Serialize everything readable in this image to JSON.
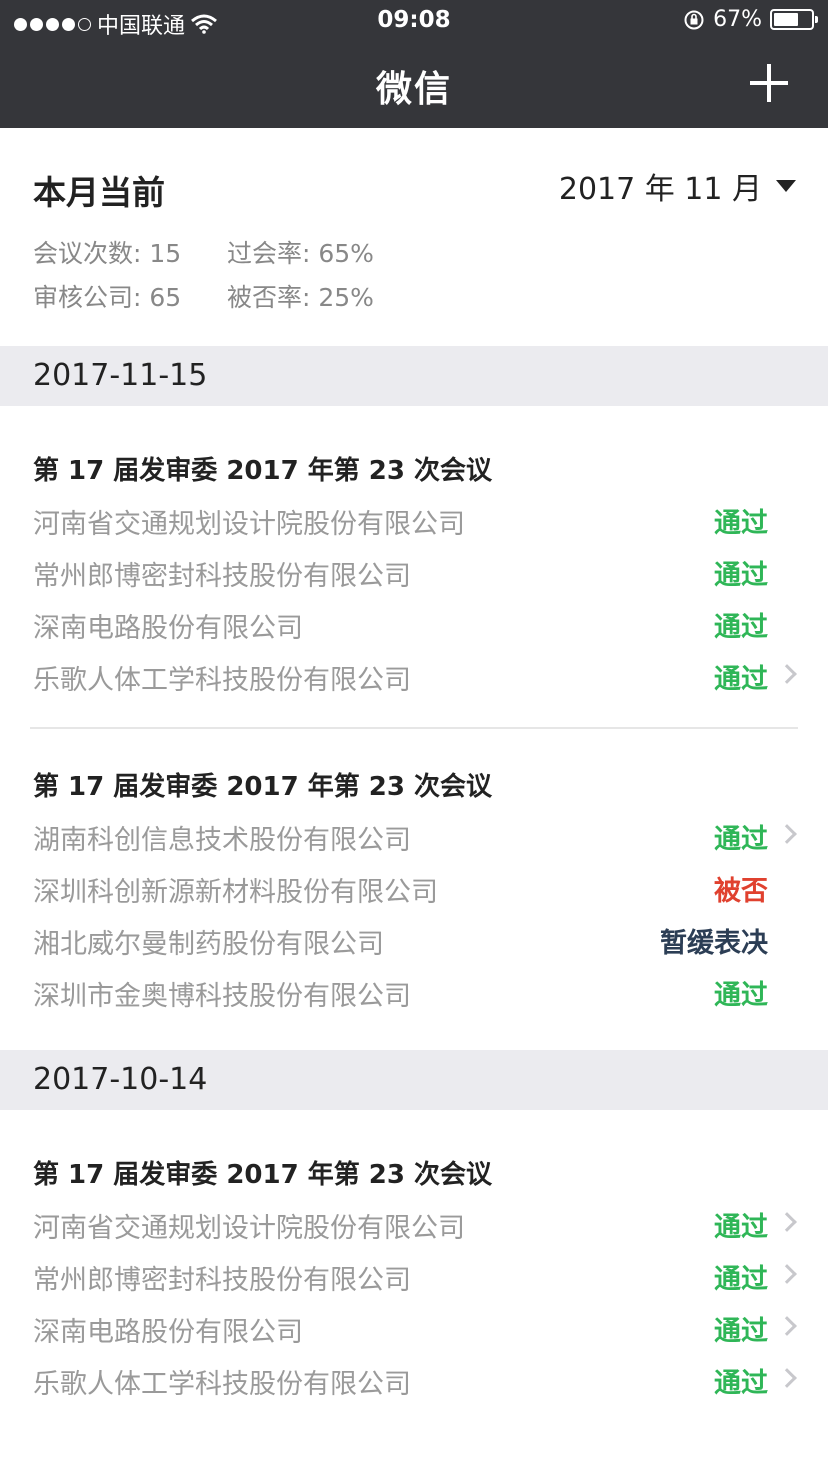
{
  "status_bar": {
    "carrier": "中国联通",
    "time": "09:08",
    "battery": "67%",
    "battery_level": 0.67
  },
  "nav": {
    "title": "微信",
    "add_icon": "plus-icon"
  },
  "summary": {
    "title": "本月当前",
    "month": "2017 年 11 月",
    "meetings_stat": "会议次数: 15",
    "pass_rate_stat": "过会率: 65%",
    "companies_stat": "审核公司: 65",
    "reject_rate_stat": "被否率: 25%"
  },
  "dates": [
    {
      "date": "2017-11-15",
      "meetings": [
        {
          "title": "第 17 届发审委 2017 年第 23 次会议",
          "rows": [
            {
              "company": "河南省交通规划设计院股份有限公司",
              "result": "通过",
              "status": "pass",
              "chevron": false
            },
            {
              "company": "常州郎博密封科技股份有限公司",
              "result": "通过",
              "status": "pass",
              "chevron": false
            },
            {
              "company": "深南电路股份有限公司",
              "result": "通过",
              "status": "pass",
              "chevron": false
            },
            {
              "company": "乐歌人体工学科技股份有限公司",
              "result": "通过",
              "status": "pass",
              "chevron": true
            }
          ]
        },
        {
          "title": "第 17 届发审委 2017 年第 23 次会议",
          "rows": [
            {
              "company": "湖南科创信息技术股份有限公司",
              "result": "通过",
              "status": "pass",
              "chevron": true
            },
            {
              "company": "深圳科创新源新材料股份有限公司",
              "result": "被否",
              "status": "reject",
              "chevron": false
            },
            {
              "company": "湘北威尔曼制药股份有限公司",
              "result": "暂缓表决",
              "status": "defer",
              "chevron": false
            },
            {
              "company": "深圳市金奥博科技股份有限公司",
              "result": "通过",
              "status": "pass",
              "chevron": false
            }
          ]
        }
      ]
    },
    {
      "date": "2017-10-14",
      "meetings": [
        {
          "title": "第 17 届发审委 2017 年第 23 次会议",
          "rows": [
            {
              "company": "河南省交通规划设计院股份有限公司",
              "result": "通过",
              "status": "pass",
              "chevron": true
            },
            {
              "company": "常州郎博密封科技股份有限公司",
              "result": "通过",
              "status": "pass",
              "chevron": true
            },
            {
              "company": "深南电路股份有限公司",
              "result": "通过",
              "status": "pass",
              "chevron": true
            },
            {
              "company": "乐歌人体工学科技股份有限公司",
              "result": "通过",
              "status": "pass",
              "chevron": true
            }
          ]
        }
      ]
    }
  ],
  "colors": {
    "nav_bg": "#35363a",
    "pass": "#2fb657",
    "reject": "#e0412f",
    "defer": "#2c3e55",
    "section_bg": "#ebebef"
  }
}
